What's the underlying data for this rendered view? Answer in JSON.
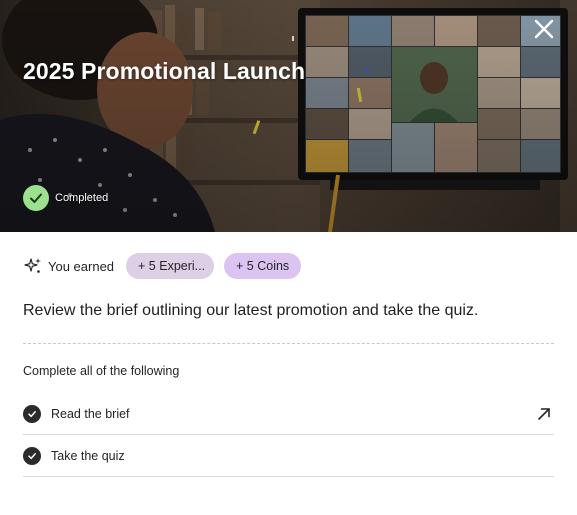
{
  "hero": {
    "title": "2025 Promotional Launch",
    "status_label": "Completed",
    "status_color": "#9ce18e",
    "close_icon": "close-icon",
    "image": "woman-on-video-call-photo"
  },
  "rewards": {
    "earned_label": "You earned",
    "icon": "sparkle-icon",
    "items": [
      {
        "label": "+ 5 Experi...",
        "color": "#dccfe6"
      },
      {
        "label": "+ 5 Coins",
        "color": "#dcc4f2"
      }
    ]
  },
  "description": "Review the brief outlining our latest promotion and take the quiz.",
  "checklist": {
    "heading": "Complete all of the following",
    "items": [
      {
        "label": "Read the brief",
        "completed": true,
        "action_icon": "open-external-arrow-icon"
      },
      {
        "label": "Take the quiz",
        "completed": true
      }
    ]
  }
}
